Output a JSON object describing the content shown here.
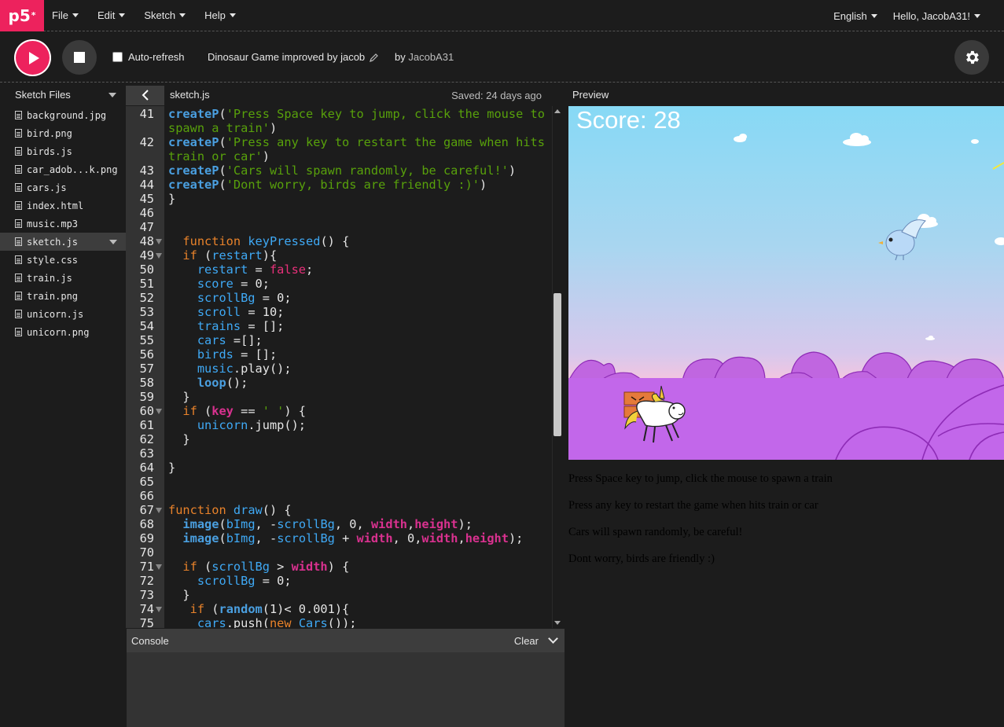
{
  "nav": {
    "logo": "p5",
    "logo_sup": "*",
    "menus": [
      "File",
      "Edit",
      "Sketch",
      "Help"
    ],
    "language": "English",
    "user_greeting": "Hello, JacobA31!"
  },
  "toolbar": {
    "auto_refresh_label": "Auto-refresh",
    "auto_refresh_checked": false,
    "sketch_name": "Dinosaur Game improved by jacob",
    "by_label": "by",
    "owner": "JacobA31"
  },
  "sidebar": {
    "title": "Sketch Files",
    "files": [
      {
        "name": "background.jpg"
      },
      {
        "name": "bird.png"
      },
      {
        "name": "birds.js"
      },
      {
        "name": "car_adob...k.png"
      },
      {
        "name": "cars.js"
      },
      {
        "name": "index.html"
      },
      {
        "name": "music.mp3"
      },
      {
        "name": "sketch.js",
        "active": true
      },
      {
        "name": "style.css"
      },
      {
        "name": "train.js"
      },
      {
        "name": "train.png"
      },
      {
        "name": "unicorn.js"
      },
      {
        "name": "unicorn.png"
      }
    ]
  },
  "editor": {
    "file_name": "sketch.js",
    "saved_status": "Saved: 24 days ago",
    "lines": [
      {
        "n": "41",
        "fold": false,
        "tokens": [
          [
            "fn",
            "createP"
          ],
          [
            "t",
            "("
          ],
          [
            "str",
            "'Press Space key to jump, click the mouse to"
          ]
        ]
      },
      {
        "n": "",
        "fold": false,
        "tokens": [
          [
            "str",
            "spawn a train'"
          ],
          [
            "t",
            ")"
          ]
        ]
      },
      {
        "n": "42",
        "fold": false,
        "tokens": [
          [
            "fn",
            "createP"
          ],
          [
            "t",
            "("
          ],
          [
            "str",
            "'Press any key to restart the game when hits"
          ]
        ]
      },
      {
        "n": "",
        "fold": false,
        "tokens": [
          [
            "str",
            "train or car'"
          ],
          [
            "t",
            ")"
          ]
        ]
      },
      {
        "n": "43",
        "fold": false,
        "tokens": [
          [
            "fn",
            "createP"
          ],
          [
            "t",
            "("
          ],
          [
            "str",
            "'Cars will spawn randomly, be careful!'"
          ],
          [
            "t",
            ")"
          ]
        ]
      },
      {
        "n": "44",
        "fold": false,
        "tokens": [
          [
            "fn",
            "createP"
          ],
          [
            "t",
            "("
          ],
          [
            "str",
            "'Dont worry, birds are friendly :)'"
          ],
          [
            "t",
            ")"
          ]
        ]
      },
      {
        "n": "45",
        "fold": false,
        "tokens": [
          [
            "t",
            "}"
          ]
        ]
      },
      {
        "n": "46",
        "fold": false,
        "tokens": []
      },
      {
        "n": "47",
        "fold": false,
        "tokens": []
      },
      {
        "n": "48",
        "fold": true,
        "tokens": [
          [
            "t",
            "  "
          ],
          [
            "kw",
            "function"
          ],
          [
            "t",
            " "
          ],
          [
            "def",
            "keyPressed"
          ],
          [
            "t",
            "() {"
          ]
        ]
      },
      {
        "n": "49",
        "fold": true,
        "tokens": [
          [
            "t",
            "  "
          ],
          [
            "kw",
            "if"
          ],
          [
            "t",
            " ("
          ],
          [
            "var",
            "restart"
          ],
          [
            "t",
            "){"
          ]
        ]
      },
      {
        "n": "50",
        "fold": false,
        "tokens": [
          [
            "t",
            "    "
          ],
          [
            "var",
            "restart"
          ],
          [
            "t",
            " = "
          ],
          [
            "bool",
            "false"
          ],
          [
            "t",
            ";"
          ]
        ]
      },
      {
        "n": "51",
        "fold": false,
        "tokens": [
          [
            "t",
            "    "
          ],
          [
            "var",
            "score"
          ],
          [
            "t",
            " = 0;"
          ]
        ]
      },
      {
        "n": "52",
        "fold": false,
        "tokens": [
          [
            "t",
            "    "
          ],
          [
            "var",
            "scrollBg"
          ],
          [
            "t",
            " = 0;"
          ]
        ]
      },
      {
        "n": "53",
        "fold": false,
        "tokens": [
          [
            "t",
            "    "
          ],
          [
            "var",
            "scroll"
          ],
          [
            "t",
            " = 10;"
          ]
        ]
      },
      {
        "n": "54",
        "fold": false,
        "tokens": [
          [
            "t",
            "    "
          ],
          [
            "var",
            "trains"
          ],
          [
            "t",
            " = [];"
          ]
        ]
      },
      {
        "n": "55",
        "fold": false,
        "tokens": [
          [
            "t",
            "    "
          ],
          [
            "var",
            "cars"
          ],
          [
            "t",
            " =[];"
          ]
        ]
      },
      {
        "n": "56",
        "fold": false,
        "tokens": [
          [
            "t",
            "    "
          ],
          [
            "var",
            "birds"
          ],
          [
            "t",
            " = [];"
          ]
        ]
      },
      {
        "n": "57",
        "fold": false,
        "tokens": [
          [
            "t",
            "    "
          ],
          [
            "var",
            "music"
          ],
          [
            "t",
            ".play();"
          ]
        ]
      },
      {
        "n": "58",
        "fold": false,
        "tokens": [
          [
            "t",
            "    "
          ],
          [
            "fn",
            "loop"
          ],
          [
            "t",
            "();"
          ]
        ]
      },
      {
        "n": "59",
        "fold": false,
        "tokens": [
          [
            "t",
            "  }"
          ]
        ]
      },
      {
        "n": "60",
        "fold": true,
        "tokens": [
          [
            "t",
            "  "
          ],
          [
            "kw",
            "if"
          ],
          [
            "t",
            " ("
          ],
          [
            "fn2",
            "key"
          ],
          [
            "t",
            " == "
          ],
          [
            "str",
            "' '"
          ],
          [
            "t",
            ") {"
          ]
        ]
      },
      {
        "n": "61",
        "fold": false,
        "tokens": [
          [
            "t",
            "    "
          ],
          [
            "var",
            "unicorn"
          ],
          [
            "t",
            ".jump();"
          ]
        ]
      },
      {
        "n": "62",
        "fold": false,
        "tokens": [
          [
            "t",
            "  }"
          ]
        ]
      },
      {
        "n": "63",
        "fold": false,
        "tokens": []
      },
      {
        "n": "64",
        "fold": false,
        "tokens": [
          [
            "t",
            "}"
          ]
        ]
      },
      {
        "n": "65",
        "fold": false,
        "tokens": []
      },
      {
        "n": "66",
        "fold": false,
        "tokens": []
      },
      {
        "n": "67",
        "fold": true,
        "tokens": [
          [
            "kw",
            "function"
          ],
          [
            "t",
            " "
          ],
          [
            "def",
            "draw"
          ],
          [
            "t",
            "() {"
          ]
        ]
      },
      {
        "n": "68",
        "fold": false,
        "tokens": [
          [
            "t",
            "  "
          ],
          [
            "fn",
            "image"
          ],
          [
            "t",
            "("
          ],
          [
            "var",
            "bImg"
          ],
          [
            "t",
            ", -"
          ],
          [
            "var",
            "scrollBg"
          ],
          [
            "t",
            ", 0, "
          ],
          [
            "fn2",
            "width"
          ],
          [
            "t",
            ","
          ],
          [
            "fn2",
            "height"
          ],
          [
            "t",
            ");"
          ]
        ]
      },
      {
        "n": "69",
        "fold": false,
        "tokens": [
          [
            "t",
            "  "
          ],
          [
            "fn",
            "image"
          ],
          [
            "t",
            "("
          ],
          [
            "var",
            "bImg"
          ],
          [
            "t",
            ", -"
          ],
          [
            "var",
            "scrollBg"
          ],
          [
            "t",
            " + "
          ],
          [
            "fn2",
            "width"
          ],
          [
            "t",
            ", 0,"
          ],
          [
            "fn2",
            "width"
          ],
          [
            "t",
            ","
          ],
          [
            "fn2",
            "height"
          ],
          [
            "t",
            ");"
          ]
        ]
      },
      {
        "n": "70",
        "fold": false,
        "tokens": []
      },
      {
        "n": "71",
        "fold": true,
        "tokens": [
          [
            "t",
            "  "
          ],
          [
            "kw",
            "if"
          ],
          [
            "t",
            " ("
          ],
          [
            "var",
            "scrollBg"
          ],
          [
            "t",
            " > "
          ],
          [
            "fn2",
            "width"
          ],
          [
            "t",
            ") {"
          ]
        ]
      },
      {
        "n": "72",
        "fold": false,
        "tokens": [
          [
            "t",
            "    "
          ],
          [
            "var",
            "scrollBg"
          ],
          [
            "t",
            " = 0;"
          ]
        ]
      },
      {
        "n": "73",
        "fold": false,
        "tokens": [
          [
            "t",
            "  }"
          ]
        ]
      },
      {
        "n": "74",
        "fold": true,
        "tokens": [
          [
            "t",
            "   "
          ],
          [
            "kw",
            "if"
          ],
          [
            "t",
            " ("
          ],
          [
            "fn",
            "random"
          ],
          [
            "t",
            "(1)< 0.001){"
          ]
        ]
      },
      {
        "n": "75",
        "fold": false,
        "tokens": [
          [
            "t",
            "    "
          ],
          [
            "var",
            "cars"
          ],
          [
            "t",
            ".push("
          ],
          [
            "kw",
            "new"
          ],
          [
            "t",
            " "
          ],
          [
            "var",
            "Cars"
          ],
          [
            "t",
            "());"
          ]
        ]
      }
    ]
  },
  "console": {
    "title": "Console",
    "clear_label": "Clear"
  },
  "preview": {
    "label": "Preview",
    "score_text": "Score: 28",
    "paragraphs": [
      "Press Space key to jump, click the mouse to spawn a train",
      "Press any key to restart the game when hits train or car",
      "Cars will spawn randomly, be careful!",
      "Dont worry, birds are friendly :)"
    ]
  },
  "colors": {
    "accent": "#ed225d",
    "background": "#1c1c1c",
    "panel": "#333333"
  }
}
